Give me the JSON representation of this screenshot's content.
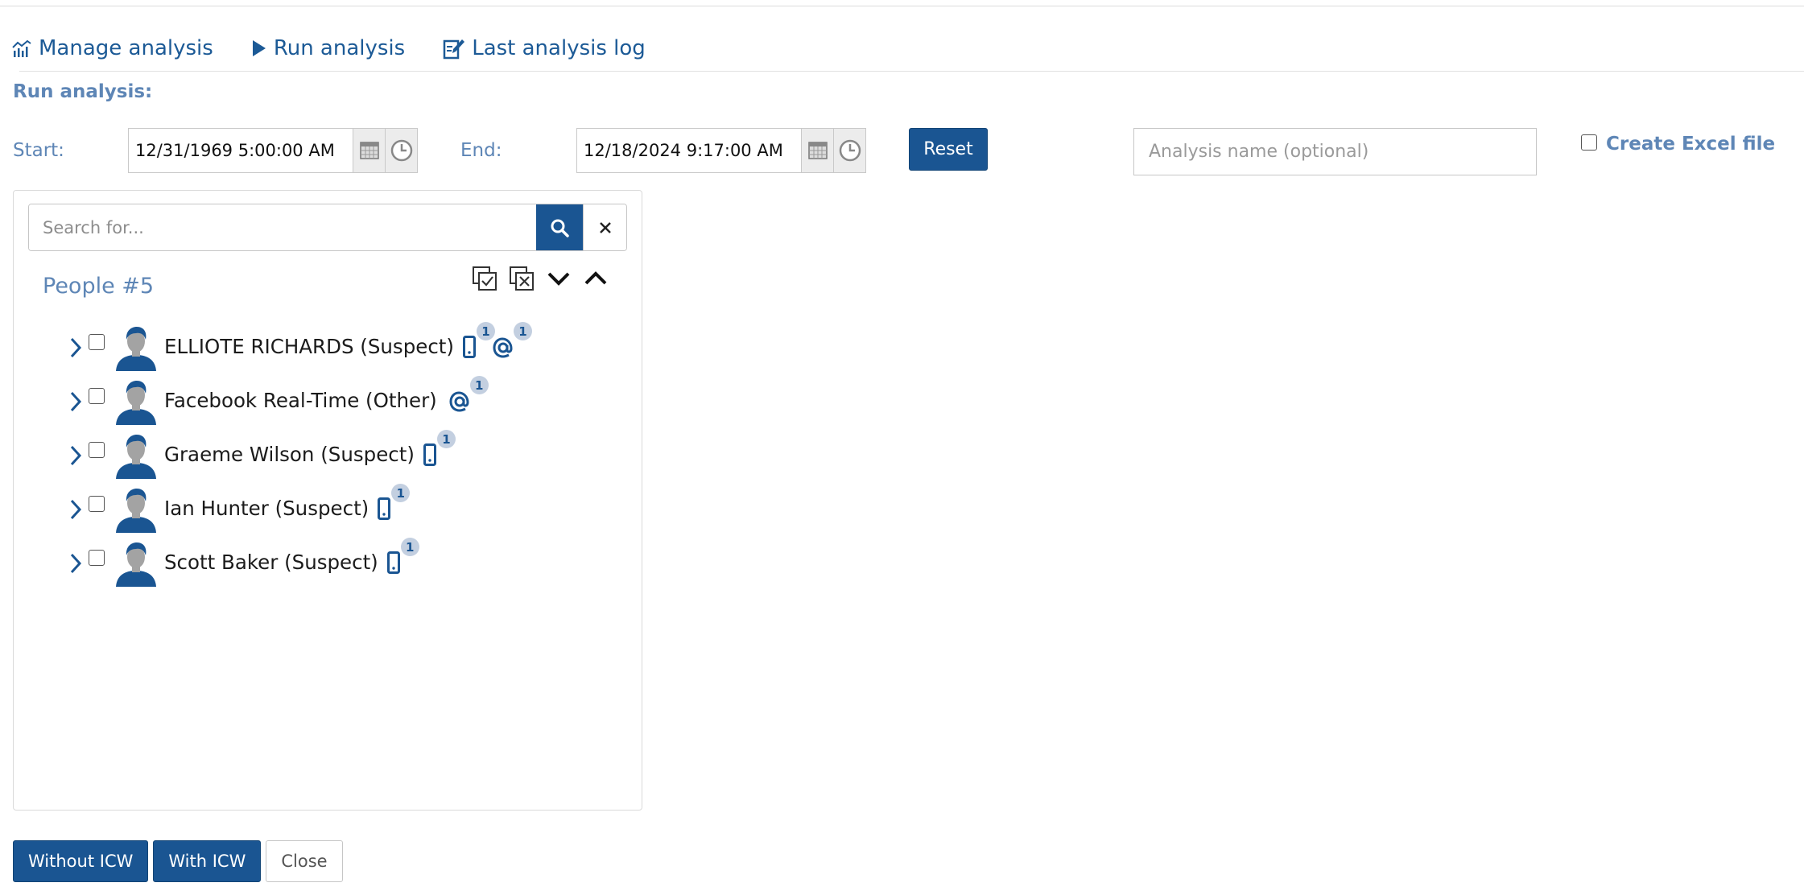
{
  "tabs": [
    {
      "label": "Manage analysis",
      "icon": "chart-icon"
    },
    {
      "label": "Run analysis",
      "icon": "play-icon"
    },
    {
      "label": "Last analysis log",
      "icon": "edit-log-icon"
    }
  ],
  "section_title": "Run analysis:",
  "start": {
    "label": "Start:",
    "value": "12/31/1969 5:00:00 AM"
  },
  "end": {
    "label": "End:",
    "value": "12/18/2024 9:17:00 AM"
  },
  "reset_label": "Reset",
  "analysis_name": {
    "placeholder": "Analysis name (optional)",
    "value": ""
  },
  "excel": {
    "label": "Create Excel file",
    "checked": false
  },
  "search": {
    "placeholder": "Search for...",
    "value": ""
  },
  "group_title": "People #5",
  "people": [
    {
      "name": "ELLIOTE RICHARDS (Suspect)",
      "phone_count": "1",
      "email_count": "1"
    },
    {
      "name": "Facebook Real-Time (Other)",
      "phone_count": null,
      "email_count": "1"
    },
    {
      "name": "Graeme Wilson (Suspect)",
      "phone_count": "1",
      "email_count": null
    },
    {
      "name": "Ian Hunter (Suspect)",
      "phone_count": "1",
      "email_count": null
    },
    {
      "name": "Scott Baker (Suspect)",
      "phone_count": "1",
      "email_count": null
    }
  ],
  "buttons": {
    "without_icw": "Without ICW",
    "with_icw": "With ICW",
    "close": "Close"
  },
  "colors": {
    "primary": "#1a5592",
    "label": "#5e86b6",
    "link": "#1c5a96",
    "badge": "#c3cfe0"
  }
}
